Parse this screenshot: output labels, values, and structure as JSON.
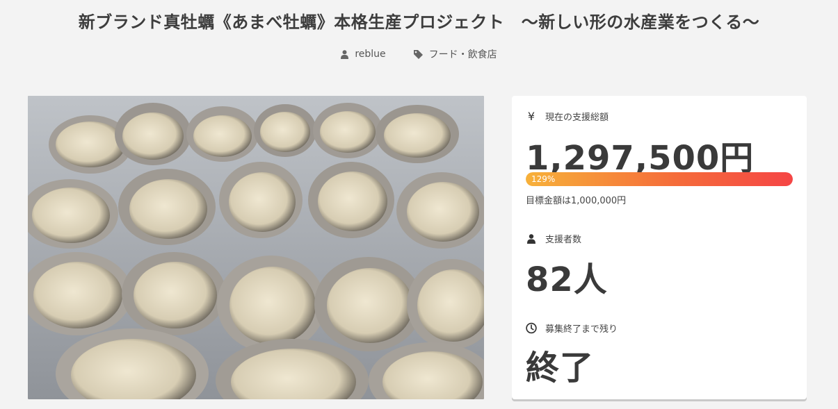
{
  "header": {
    "title": "新ブランド真牡蠣《あまべ牡蠣》本格生産プロジェクト　～新しい形の水産業をつくる～",
    "author": "reblue",
    "category": "フード・飲食店"
  },
  "hero": {
    "alt": "oysters"
  },
  "stats": {
    "currency_symbol": "¥",
    "current_label": "現在の支援総額",
    "current_amount": "1,297,500円",
    "progress_percent": 129,
    "progress_text": "129%",
    "goal_text": "目標金額は1,000,000円",
    "supporters_label": "支援者数",
    "supporters_count": "82人",
    "remaining_label": "募集終了まで残り",
    "remaining_value": "終了"
  },
  "colors": {
    "progress_start": "#f7b13a",
    "progress_end": "#f54545",
    "panel_bg": "#ffffff",
    "page_bg": "#f3f3f3"
  }
}
